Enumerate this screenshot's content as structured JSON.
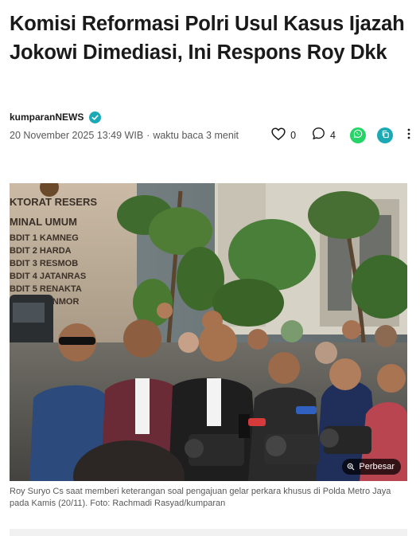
{
  "article": {
    "headline": "Komisi Reformasi Polri Usul Kasus Ijazah Jokowi Dimediasi, Ini Respons Roy Dkk",
    "publisher": "kumparanNEWS",
    "date": "20 November 2025 13:49 WIB",
    "separator": "·",
    "reading_time": "waktu baca 3 menit"
  },
  "actions": {
    "like_count": "0",
    "comment_count": "4",
    "icons": [
      "heart-icon",
      "comment-icon",
      "whatsapp-icon",
      "copy-link-icon",
      "more-vertical-icon"
    ]
  },
  "photo": {
    "zoom_label": "Perbesar",
    "sign_lines": [
      "KTORAT RESERS",
      "MINAL UMUM",
      "BDIT 1 KAMNEG",
      "BDIT 2 HARDA",
      "BDIT 3 RESMOB",
      "BDIT 4 JATANRAS",
      "BDIT 5 RENAKTA",
      "BDIT 6 RANMOR"
    ],
    "caption": "Roy Suryo Cs saat memberi keterangan soal pengajuan gelar perkara khusus di Polda Metro Jaya pada Kamis (20/11). Foto: Rachmadi Rasyad/kumparan"
  },
  "colors": {
    "accent_teal": "#1aa9b5",
    "whatsapp_green": "#25d366",
    "text_dark": "#1a1a1a",
    "text_muted": "#585858"
  }
}
